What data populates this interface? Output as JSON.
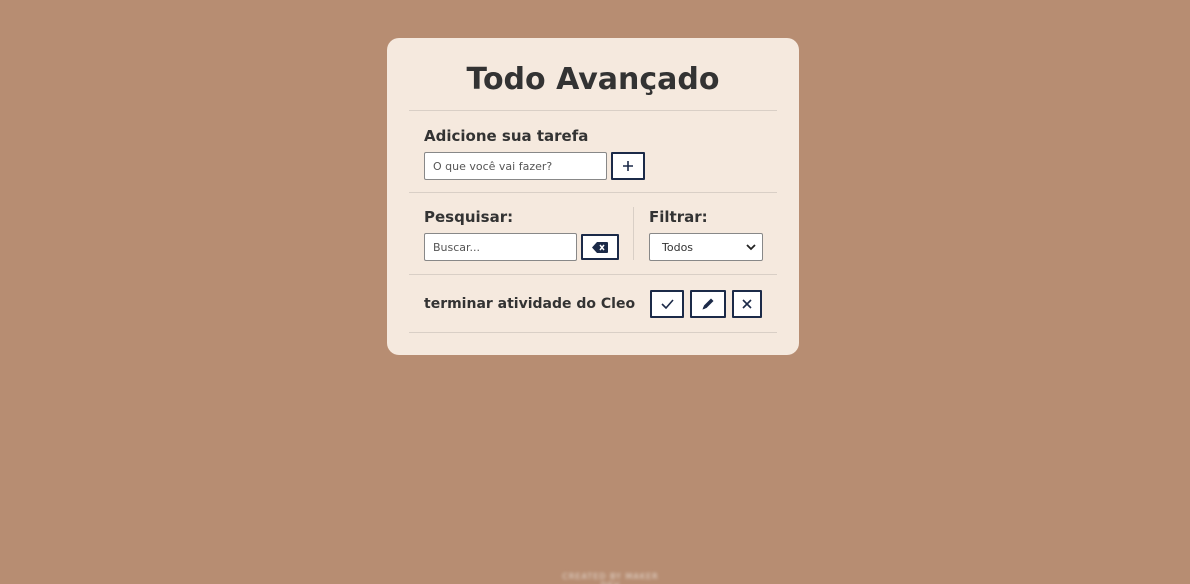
{
  "app": {
    "title": "Todo Avançado"
  },
  "add_section": {
    "label": "Adicione sua tarefa",
    "input_placeholder": "O que você vai fazer?",
    "add_button_icon": "plus-icon"
  },
  "search": {
    "label": "Pesquisar:",
    "input_placeholder": "Buscar...",
    "clear_button_icon": "backspace-icon"
  },
  "filter": {
    "label": "Filtrar:",
    "selected": "Todos"
  },
  "todos": [
    {
      "text": "terminar atividade do Cleo",
      "actions": [
        "check-icon",
        "pencil-icon",
        "close-icon"
      ]
    }
  ],
  "footer": {
    "text": "CREATED BY MAKER DEV"
  },
  "colors": {
    "background": "#b78d72",
    "card": "#f5e9de",
    "button_border": "#1b2a48",
    "text": "#333333"
  }
}
